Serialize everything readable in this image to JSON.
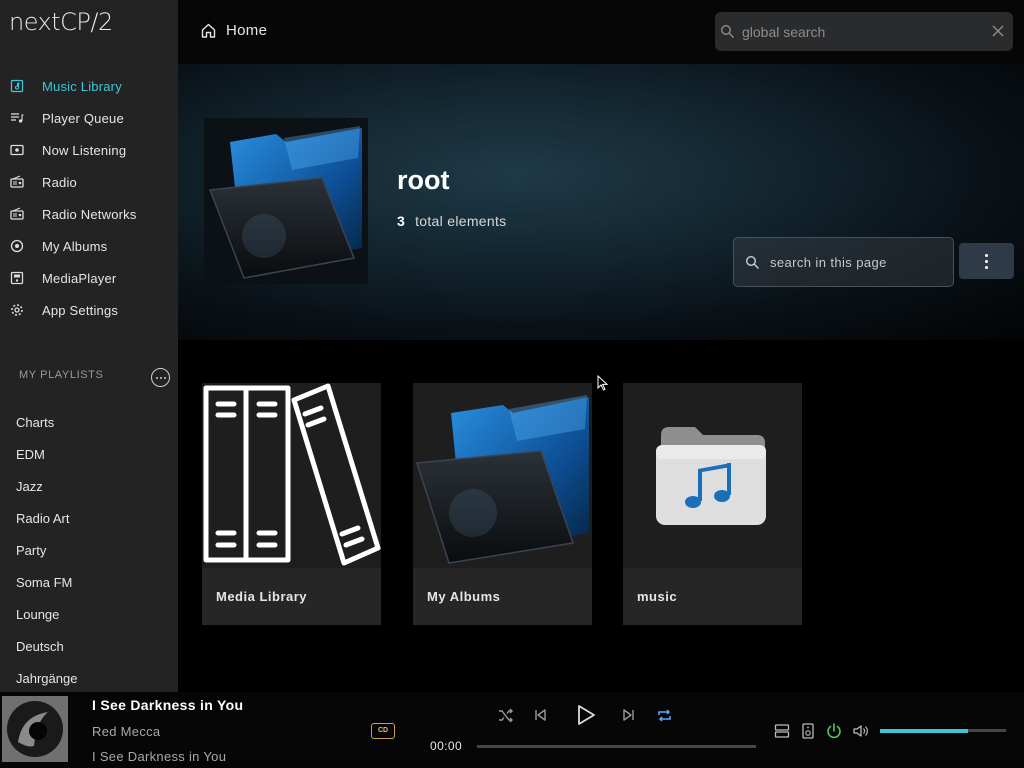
{
  "app": {
    "brand": "nextCP/2"
  },
  "sidebar": {
    "items": [
      {
        "label": "Music Library",
        "icon": "music-library-icon",
        "active": true
      },
      {
        "label": "Player Queue",
        "icon": "queue-icon",
        "active": false
      },
      {
        "label": "Now Listening",
        "icon": "now-listening-icon",
        "active": false
      },
      {
        "label": "Radio",
        "icon": "radio-icon",
        "active": false
      },
      {
        "label": "Radio Networks",
        "icon": "radio-networks-icon",
        "active": false
      },
      {
        "label": "My Albums",
        "icon": "album-icon",
        "active": false
      },
      {
        "label": "MediaPlayer",
        "icon": "media-player-icon",
        "active": false
      },
      {
        "label": "App Settings",
        "icon": "gear-icon",
        "active": false
      }
    ],
    "playlists_header": "MY PLAYLISTS",
    "playlists": [
      "Charts",
      "EDM",
      "Jazz",
      "Radio Art",
      "Party",
      "Soma FM",
      "Lounge",
      "Deutsch",
      "Jahrgänge"
    ]
  },
  "topbar": {
    "home_label": "Home",
    "global_search_placeholder": "global search"
  },
  "hero": {
    "title": "root",
    "count": "3",
    "count_label": "total elements",
    "page_search_placeholder": "search in this page"
  },
  "cards": [
    {
      "label": "Media Library",
      "icon": "books-icon"
    },
    {
      "label": "My Albums",
      "icon": "folder-icon"
    },
    {
      "label": "music",
      "icon": "music-folder-icon"
    }
  ],
  "player": {
    "track_title": "I See Darkness in You",
    "artist": "Red Mecca",
    "album": "I See Darkness in You",
    "format_badge": "CD",
    "time": "00:00",
    "progress": 0,
    "volume": 0.7,
    "colors": {
      "accent": "#3ec6d8",
      "repeat_active": "#5aa8ff",
      "power": "#4fc95f"
    }
  }
}
